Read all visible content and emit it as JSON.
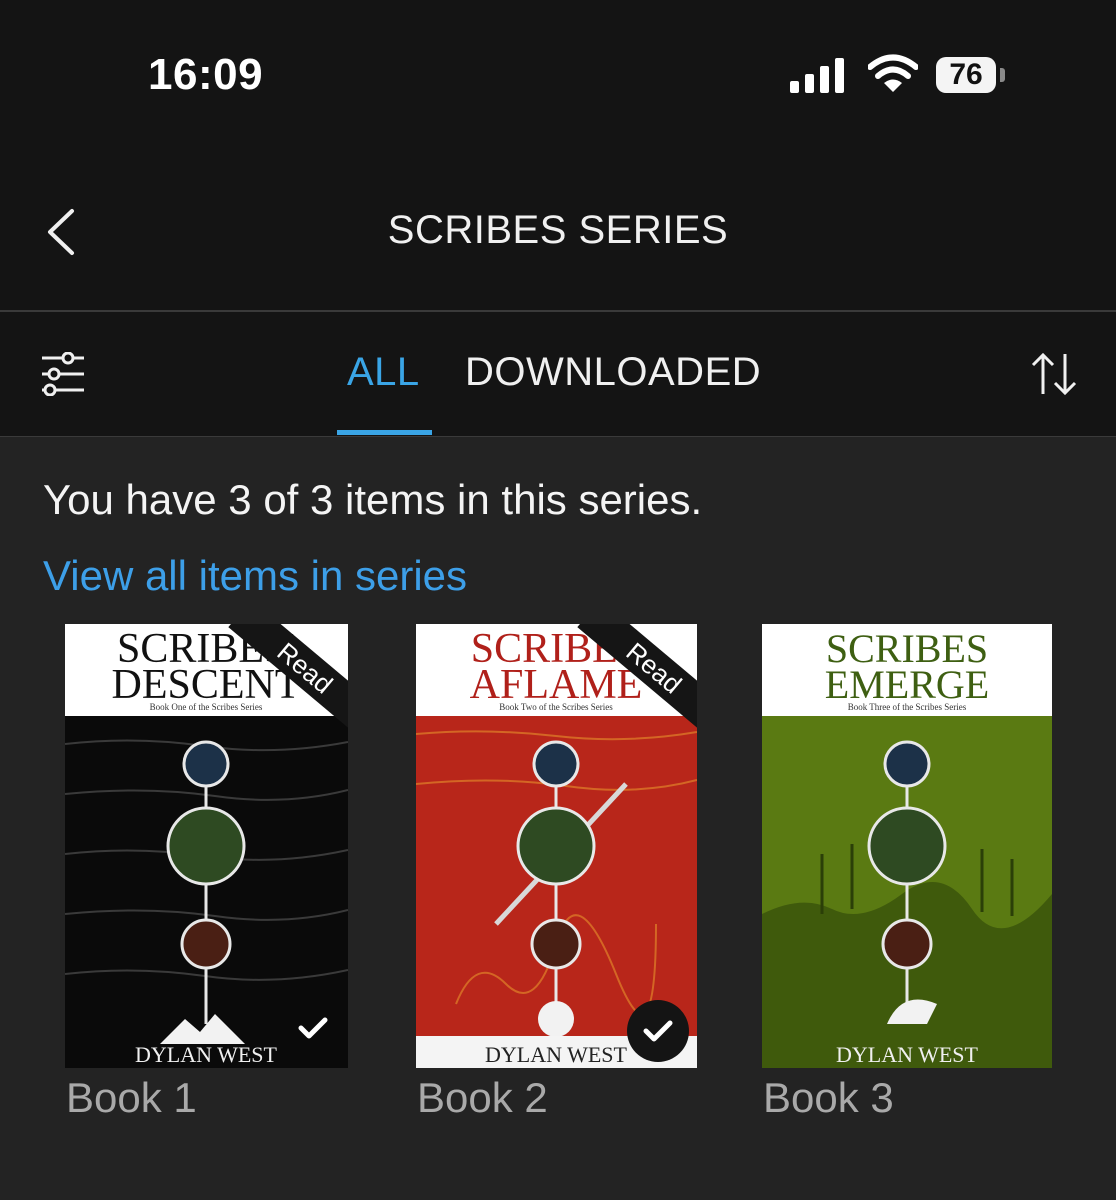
{
  "status": {
    "time": "16:09",
    "battery": "76"
  },
  "header": {
    "title": "SCRIBES SERIES"
  },
  "tabs": {
    "all": "ALL",
    "downloaded": "DOWNLOADED"
  },
  "series": {
    "count_text": "You have 3 of 3 items in this series.",
    "view_all": "View all items in series"
  },
  "books": [
    {
      "label": "Book 1",
      "cover_title_1": "SCRIBES'",
      "cover_title_2": "DESCENT",
      "cover_subtitle": "Book One of the Scribes Series",
      "cover_author": "DYLAN WEST",
      "ribbon": "Read",
      "cover_color": "#0a0a0a"
    },
    {
      "label": "Book 2",
      "cover_title_1": "SCRIBES",
      "cover_title_2": "AFLAME",
      "cover_subtitle": "Book Two of the Scribes Series",
      "cover_author": "DYLAN WEST",
      "ribbon": "Read",
      "cover_color": "#b8261a"
    },
    {
      "label": "Book 3",
      "cover_title_1": "SCRIBES",
      "cover_title_2": "EMERGE",
      "cover_subtitle": "Book Three of the Scribes Series",
      "cover_author": "DYLAN WEST",
      "cover_color": "#5a7a12"
    }
  ],
  "colors": {
    "accent": "#3aa5e6",
    "background": "#232323",
    "bar": "#141414"
  }
}
